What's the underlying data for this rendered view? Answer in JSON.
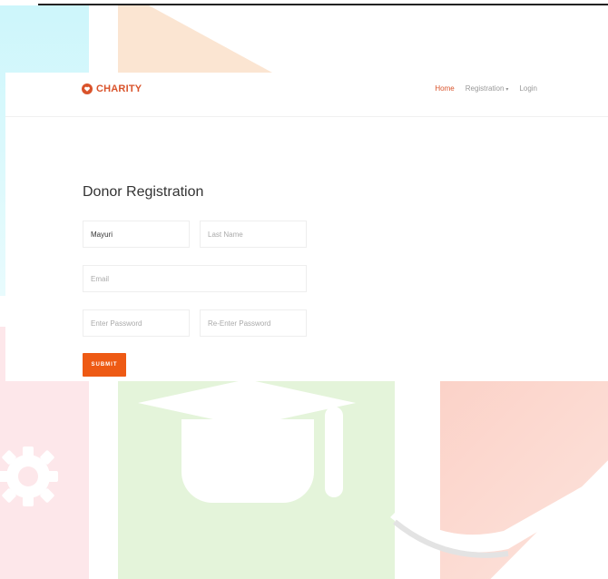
{
  "brand": {
    "name": "CHARITY",
    "icon": "charity-logo-icon",
    "color": "#d9532b"
  },
  "nav": {
    "items": [
      {
        "label": "Home",
        "active": true
      },
      {
        "label": "Registration",
        "dropdown": true
      },
      {
        "label": "Login"
      }
    ],
    "caret": "▾"
  },
  "form": {
    "title": "Donor Registration",
    "first_name": {
      "value": "Mayuri",
      "placeholder": "First Name"
    },
    "last_name": {
      "value": "",
      "placeholder": "Last Name"
    },
    "email": {
      "value": "",
      "placeholder": "Email"
    },
    "password": {
      "value": "",
      "placeholder": "Enter Password"
    },
    "re_password": {
      "value": "",
      "placeholder": "Re-Enter Password"
    },
    "submit_label": "SUBMIT",
    "accent": "#ee5a14"
  }
}
